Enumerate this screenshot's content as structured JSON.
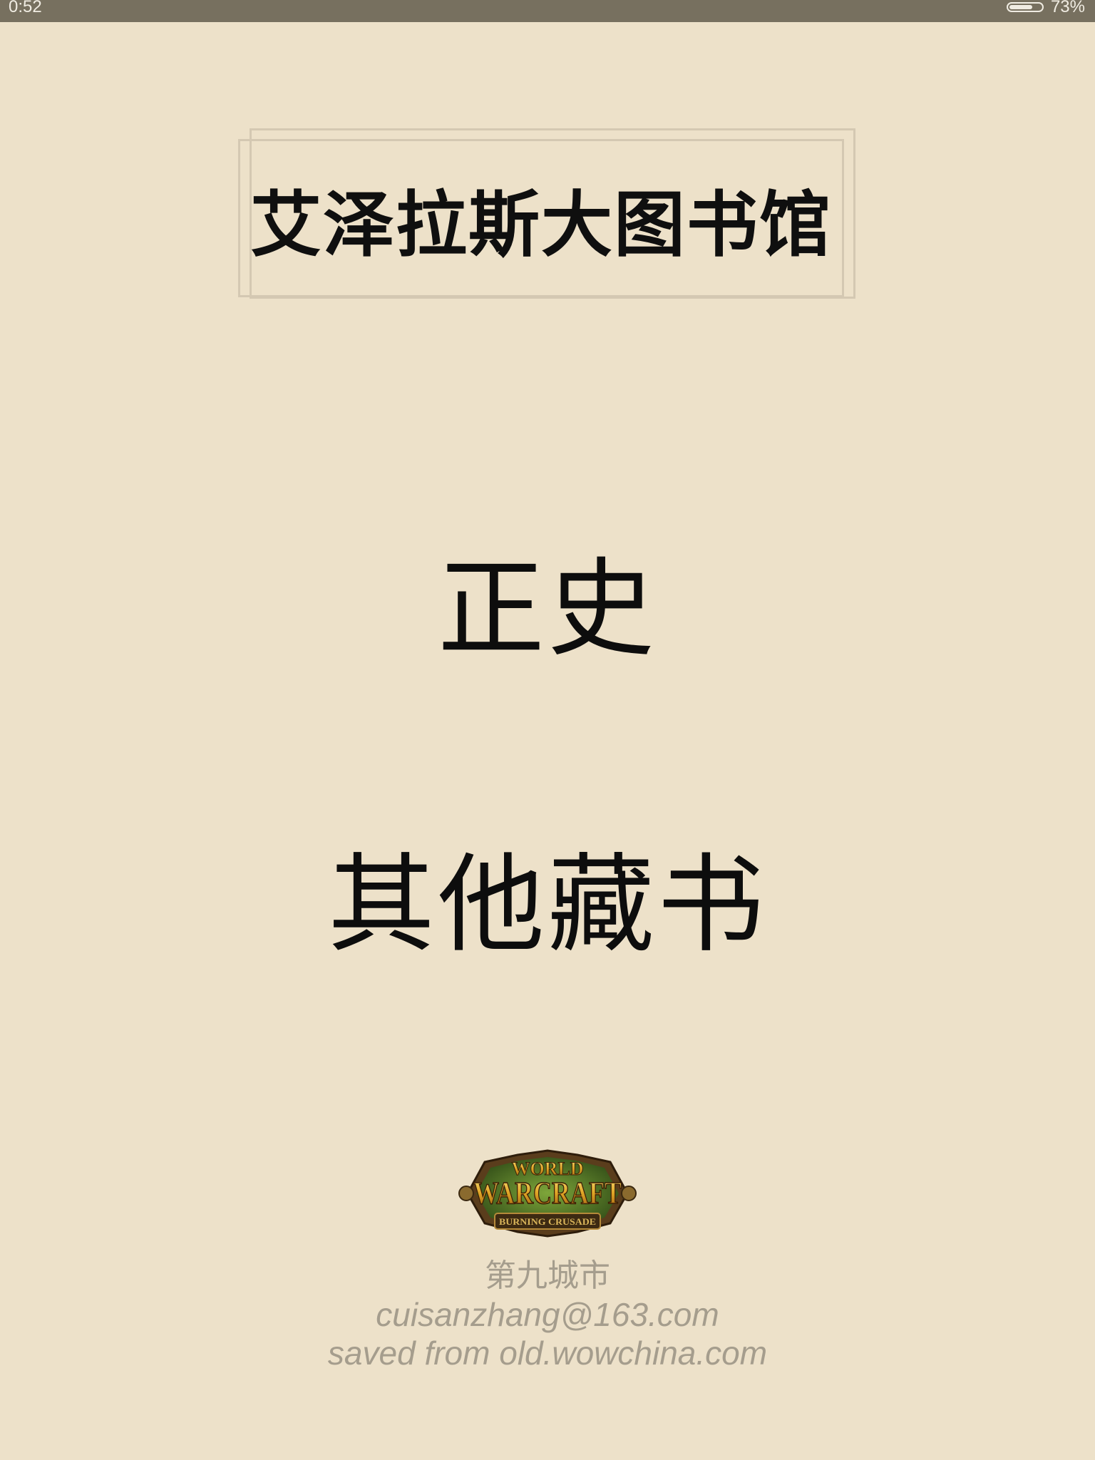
{
  "status_bar": {
    "time": "0:52",
    "battery_percent": "73%",
    "battery_level": 0.73
  },
  "header": {
    "title": "艾泽拉斯大图书馆"
  },
  "menu": {
    "items": [
      {
        "label": "正史"
      },
      {
        "label": "其他藏书"
      }
    ]
  },
  "logo": {
    "text_top": "WORLD",
    "text_main": "WARCRAFT",
    "text_bottom": "BURNING CRUSADE"
  },
  "footer": {
    "author": "第九城市",
    "email": "cuisanzhang@163.com",
    "source": "saved from old.wowchina.com"
  }
}
